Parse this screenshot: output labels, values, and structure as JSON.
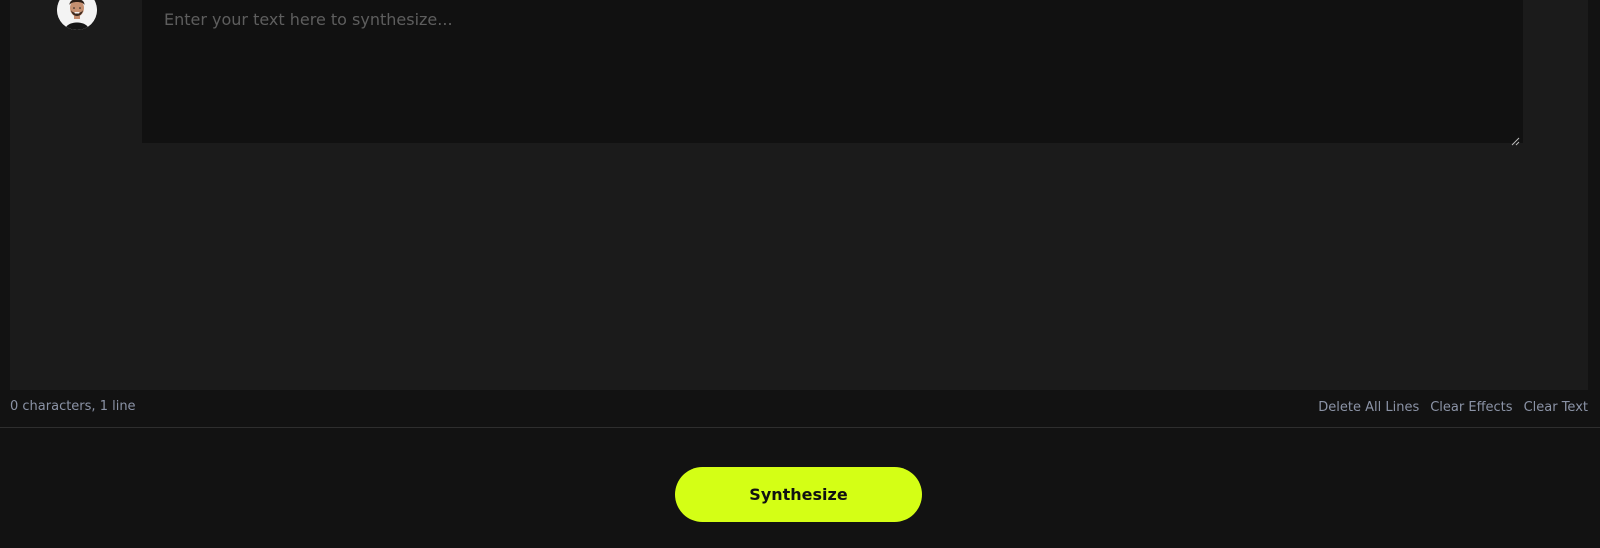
{
  "editor": {
    "placeholder": "Enter your text here to synthesize...",
    "value": ""
  },
  "status": {
    "char_count": "0 characters, 1 line"
  },
  "actions": {
    "delete_all_lines": "Delete All Lines",
    "clear_effects": "Clear Effects",
    "clear_text": "Clear Text"
  },
  "synthesize": {
    "label": "Synthesize"
  },
  "colors": {
    "accent": "#d4ff15",
    "background": "#121212",
    "panel": "#1b1b1b",
    "muted_text": "#8b93a6"
  },
  "icons": {
    "avatar": "speaker-avatar",
    "resize": "resize-grip-icon"
  }
}
